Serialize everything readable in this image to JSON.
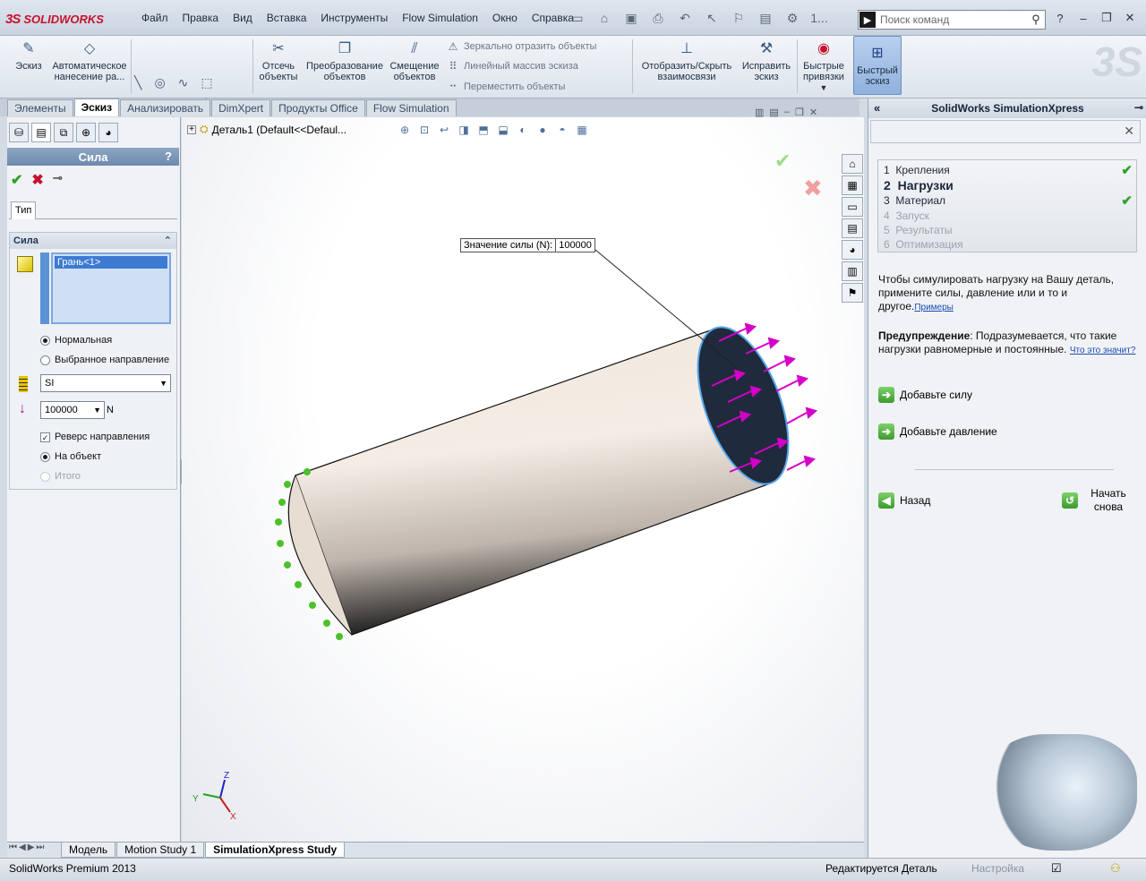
{
  "app": {
    "logo": "SOLIDWORKS",
    "logo_mark": "3S"
  },
  "menu": [
    "Файл",
    "Правка",
    "Вид",
    "Вставка",
    "Инструменты",
    "Flow Simulation",
    "Окно",
    "Справка"
  ],
  "qat_extra": "1...",
  "search": {
    "placeholder": "Поиск команд"
  },
  "ribbon": {
    "sketch": "Эскиз",
    "auto_dim": "Автоматическое нанесение ра...",
    "trim": "Отсечь объекты",
    "convert": "Преобразование объектов",
    "offset": "Смещение объектов",
    "mirror": "Зеркально отразить объекты",
    "linear": "Линейный массив эскиза",
    "move": "Переместить объекты",
    "relations": "Отобразить/Скрыть взаимосвязи",
    "repair": "Исправить эскиз",
    "quick_snaps": "Быстрые привязки",
    "rapid_sketch": "Быстрый эскиз"
  },
  "tabs": [
    "Элементы",
    "Эскиз",
    "Анализировать",
    "DimXpert",
    "Продукты Office",
    "Flow Simulation"
  ],
  "active_tab": "Эскиз",
  "pm": {
    "title": "Сила",
    "help": "?",
    "tab": "Тип",
    "group": "Сила",
    "face": "Грань<1>",
    "normal": "Нормальная",
    "selected_dir": "Выбранное направление",
    "units": "SI",
    "value": "100000",
    "unit": "N",
    "reverse": "Реверс направления",
    "per_item": "На объект",
    "total": "Итого"
  },
  "viewport": {
    "tree_label": "Деталь1  (Default<<Defaul...",
    "callout_label": "Значение силы (N):",
    "callout_value": "100000"
  },
  "axes": {
    "x": "X",
    "y": "Y",
    "z": "Z"
  },
  "simx": {
    "title": "SolidWorks SimulationXpress",
    "steps": [
      {
        "num": "1",
        "label": "Крепления",
        "done": true,
        "state": "normal"
      },
      {
        "num": "2",
        "label": "Нагрузки",
        "done": false,
        "state": "current"
      },
      {
        "num": "3",
        "label": "Материал",
        "done": true,
        "state": "normal"
      },
      {
        "num": "4",
        "label": "Запуск",
        "done": false,
        "state": "disabled"
      },
      {
        "num": "5",
        "label": "Результаты",
        "done": false,
        "state": "disabled"
      },
      {
        "num": "6",
        "label": "Оптимизация",
        "done": false,
        "state": "disabled"
      }
    ],
    "intro": "Чтобы симулировать нагрузку на Вашу деталь, примените силы, давление или и то и другое.",
    "examples_link": "Примеры",
    "warning_title": "Предупреждение",
    "warning_text": ": Подразумевается, что такие нагрузки равномерные и постоянные.",
    "what_link": "Что это значит?",
    "add_force": "Добавьте силу",
    "add_pressure": "Добавьте давление",
    "back": "Назад",
    "restart": "Начать снова"
  },
  "bottom_tabs": [
    "Модель",
    "Motion Study 1",
    "SimulationXpress Study"
  ],
  "status": {
    "product": "SolidWorks Premium 2013",
    "mode": "Редактируется Деталь",
    "settings": "Настройка"
  }
}
